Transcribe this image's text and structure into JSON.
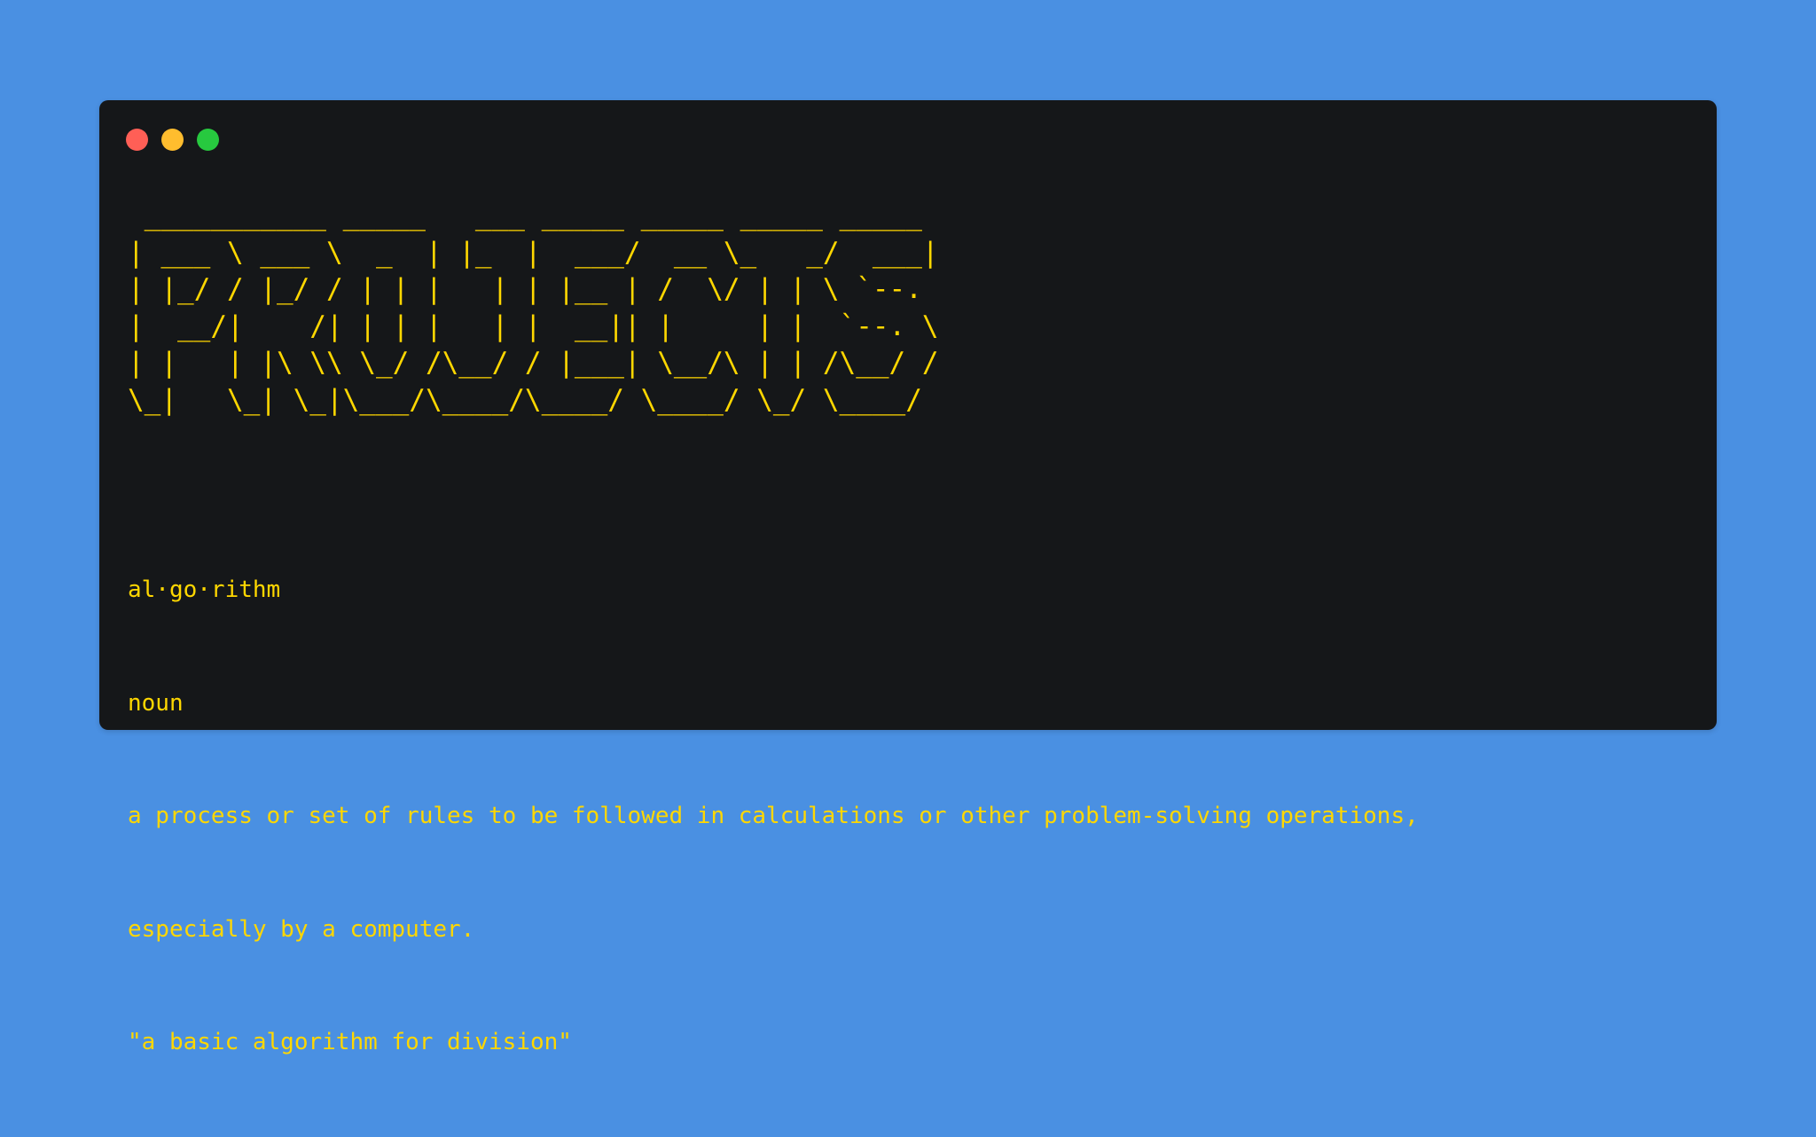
{
  "window": {
    "dot_colors": [
      "#ff5f56",
      "#ffbd2e",
      "#27c93f"
    ]
  },
  "ascii_art": {
    "lines": [
      " ___________ _____   ___ _____ _____ _____ _____ ",
      "| ___ \\ ___ \\  _  | |_  |  ___/  __ \\_   _/  ___|",
      "| |_/ / |_/ / | | |   | | |__ | /  \\/ | | \\ `--. ",
      "|  __/|    /| | | |   | |  __|| |     | |  `--. \\",
      "| |   | |\\ \\\\ \\_/ /\\__/ / |___| \\__/\\ | | /\\__/ /",
      "\\_|   \\_| \\_|\\___/\\____/\\____/ \\____/ \\_/ \\____/ "
    ]
  },
  "definition": {
    "word": "al·go·rithm",
    "part_of_speech": "noun",
    "meaning_line1": "a process or set of rules to be followed in calculations or other problem-solving operations,",
    "meaning_line2": "especially by a computer.",
    "example": "\"a basic algorithm for division\""
  }
}
